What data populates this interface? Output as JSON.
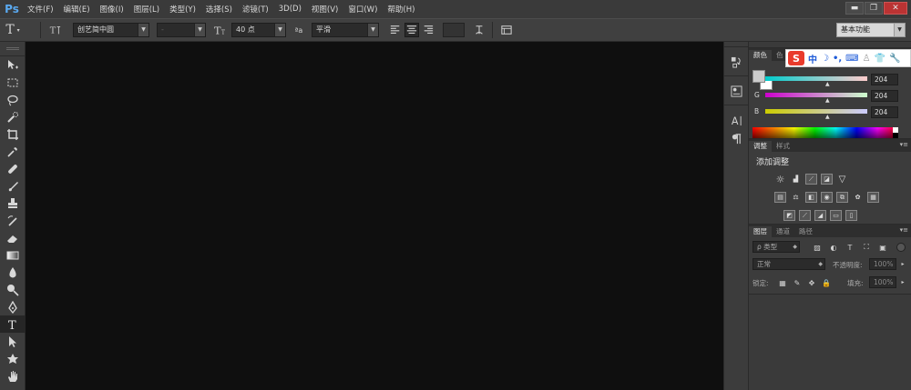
{
  "app": {
    "logo": "Ps"
  },
  "menu": [
    "文件(F)",
    "编辑(E)",
    "图像(I)",
    "图层(L)",
    "类型(Y)",
    "选择(S)",
    "滤镜(T)",
    "3D(D)",
    "视图(V)",
    "窗口(W)",
    "帮助(H)"
  ],
  "window_controls": {
    "minimize": "▬",
    "restore": "❐",
    "close": "✕"
  },
  "options": {
    "tool_glyph": "T",
    "font_family": "创艺简中圆",
    "font_style": "-",
    "font_size": "40 点",
    "aa_label": "ªa",
    "antialias": "平滑",
    "workspace": "基本功能"
  },
  "color_panel": {
    "tabs": [
      "颜色",
      "色"
    ],
    "channels": [
      {
        "label": "R",
        "value": "204"
      },
      {
        "label": "G",
        "value": "204"
      },
      {
        "label": "B",
        "value": "204"
      }
    ]
  },
  "ime_bar": {
    "logo": "S",
    "items": [
      "中",
      "☽",
      "•,",
      "⌨",
      "♙",
      "👕",
      "🔧"
    ]
  },
  "adjust_panel": {
    "tabs": [
      "调整",
      "样式"
    ],
    "title": "添加调整"
  },
  "layers_panel": {
    "tabs": [
      "图层",
      "通道",
      "路径"
    ],
    "filter_label": "ρ 类型",
    "blend_mode": "正常",
    "opacity_label": "不透明度:",
    "opacity_value": "100%",
    "lock_label": "锁定:",
    "fill_label": "填充:",
    "fill_value": "100%"
  },
  "dock": {
    "items": [
      "swatches-history",
      "properties",
      "character",
      "paragraph"
    ]
  },
  "colors": {
    "menubar": "#3a3a3a",
    "canvas": "#0f0f0f",
    "panel": "#3c3c3c",
    "brand": "#5aa9f0",
    "ime_red": "#e93b2c",
    "ime_blue": "#1e5bd8"
  }
}
